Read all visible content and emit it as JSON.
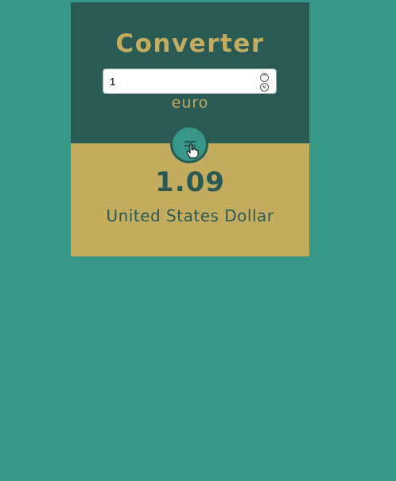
{
  "colors": {
    "page_background": "#369787",
    "top_panel": "#2a5a54",
    "bottom_panel": "#c4ac5e",
    "accent_gold": "#c4ac5e",
    "dark_green": "#2a5a54"
  },
  "converter": {
    "title": "Converter",
    "amount_value": "1",
    "from_currency": "euro",
    "swap_icon": "swap-lines-icon",
    "result_value": "1.09",
    "to_currency": "United States Dollar"
  }
}
